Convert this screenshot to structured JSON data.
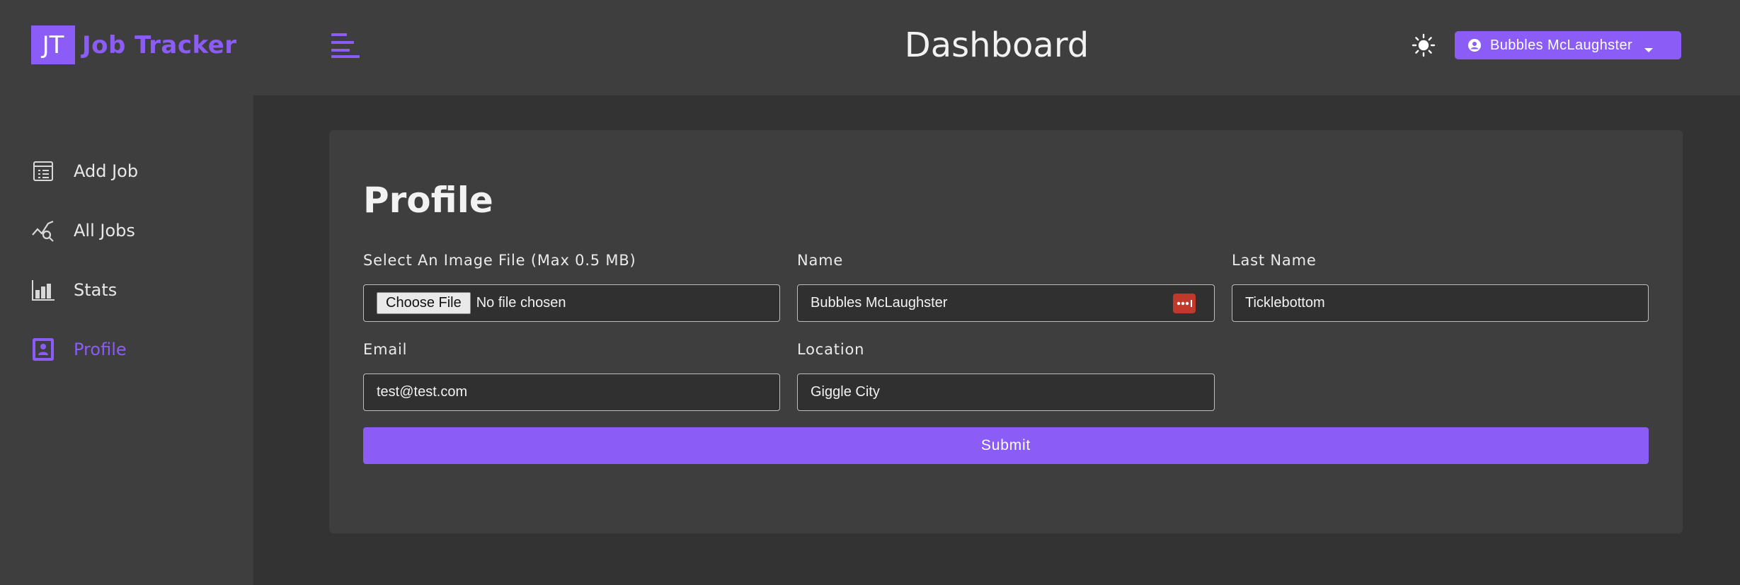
{
  "brand": {
    "mark": "JT",
    "name": "Job Tracker"
  },
  "sidebar": {
    "items": [
      {
        "label": "Add Job",
        "icon": "add-job-icon"
      },
      {
        "label": "All Jobs",
        "icon": "all-jobs-icon"
      },
      {
        "label": "Stats",
        "icon": "stats-icon"
      },
      {
        "label": "Profile",
        "icon": "profile-icon",
        "active": true
      }
    ]
  },
  "header": {
    "title": "Dashboard",
    "user_name": "Bubbles McLaughster"
  },
  "profile": {
    "title": "Profile",
    "image_label": "Select An Image File (Max 0.5 MB)",
    "file_button": "Choose File",
    "file_status": "No file chosen",
    "name_label": "Name",
    "name_value": "Bubbles McLaughster",
    "last_name_label": "Last Name",
    "last_name_value": "Ticklebottom",
    "email_label": "Email",
    "email_value": "test@test.com",
    "location_label": "Location",
    "location_value": "Giggle City",
    "submit_label": "Submit"
  },
  "colors": {
    "accent": "#8b5cf6",
    "background": "#333333",
    "panel": "#3e3e3e",
    "password_manager": "#c0392b"
  }
}
